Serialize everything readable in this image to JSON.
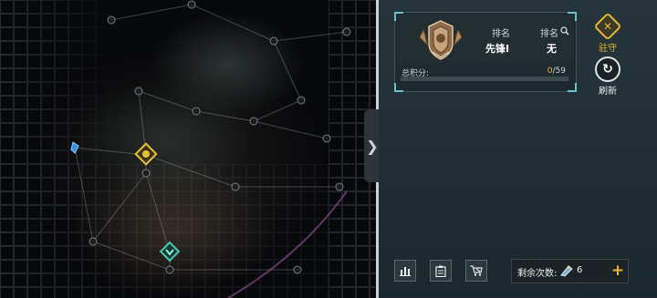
{
  "rank_card": {
    "rank_label": "排名",
    "rank_value": "先锋I",
    "position_label": "排名",
    "position_value": "无",
    "score_label": "总积分:",
    "score_current": "0",
    "score_max": "/59",
    "score_progress": 0
  },
  "side_buttons": {
    "garrison_label": "驻守",
    "refresh_label": "刷新"
  },
  "bottom_bar": {
    "remaining_label": "剩余次数:",
    "remaining_count": "6"
  },
  "colors": {
    "accent_gold": "#e7b536",
    "accent_teal": "#69c0c7",
    "panel_bg": "#22323a"
  },
  "icons": [
    "search-icon",
    "rank-badge-icon",
    "garrison-icon",
    "refresh-icon",
    "stats-icon",
    "clipboard-icon",
    "cart-icon",
    "bolt-icon",
    "plus-icon",
    "expand-arrow-icon"
  ]
}
